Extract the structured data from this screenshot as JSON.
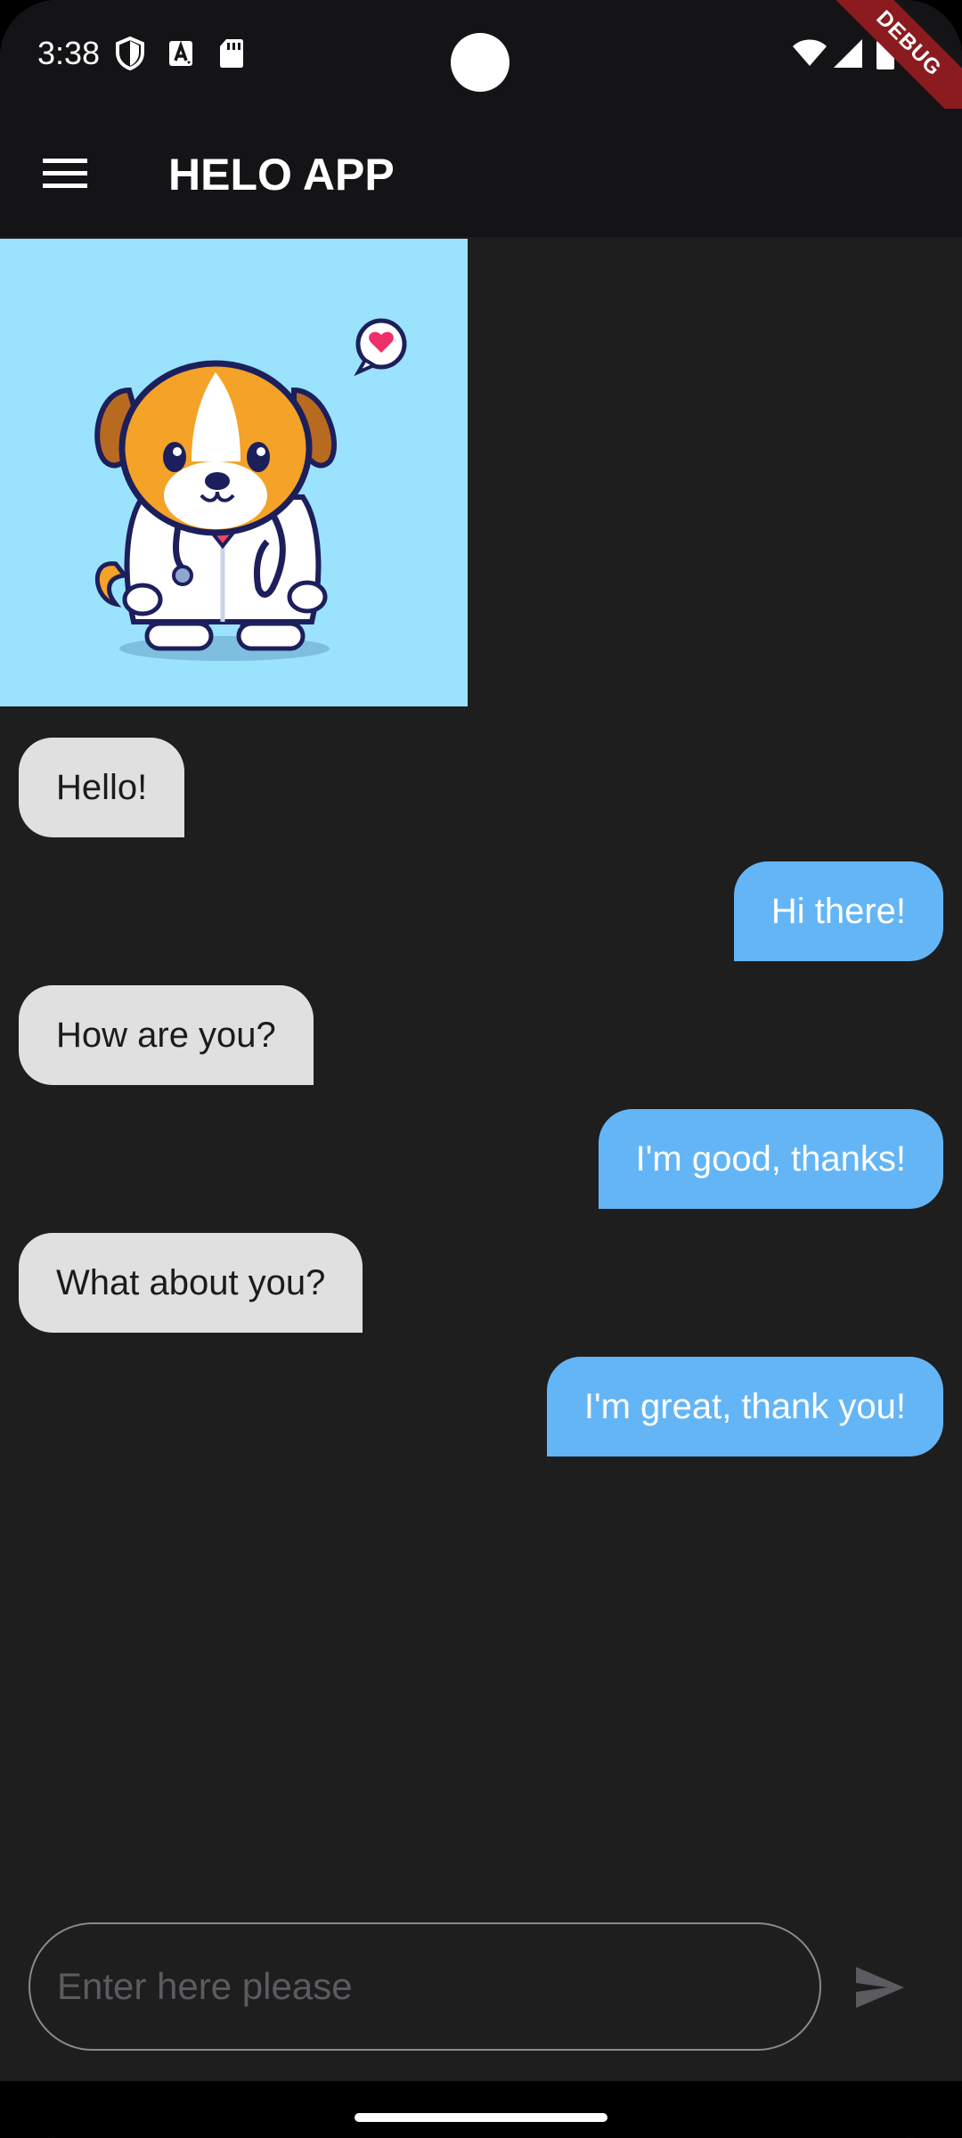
{
  "status_bar": {
    "time": "3:38",
    "icons": [
      "shield-icon",
      "font-a-icon",
      "sd-card-icon",
      "wifi-icon",
      "signal-icon",
      "battery-icon"
    ],
    "debug_label": "DEBUG"
  },
  "app_bar": {
    "title": "HELO APP",
    "menu_icon": "hamburger-menu-icon"
  },
  "hero": {
    "image": "dog-doctor-illustration",
    "background_color": "#9be2fc"
  },
  "messages": [
    {
      "sender": "other",
      "text": "Hello!"
    },
    {
      "sender": "me",
      "text": "Hi there!"
    },
    {
      "sender": "other",
      "text": "How are you?"
    },
    {
      "sender": "me",
      "text": "I'm good, thanks!"
    },
    {
      "sender": "other",
      "text": "What about you?"
    },
    {
      "sender": "me",
      "text": "I'm great, thank you!"
    }
  ],
  "composer": {
    "placeholder": "Enter here please",
    "value": "",
    "send_icon": "send-icon"
  },
  "colors": {
    "background": "#1e1e1f",
    "app_bar": "#141416",
    "incoming_bubble": "#e0e0e0",
    "outgoing_bubble": "#64b5f6",
    "debug_banner": "#8c1b1f"
  }
}
